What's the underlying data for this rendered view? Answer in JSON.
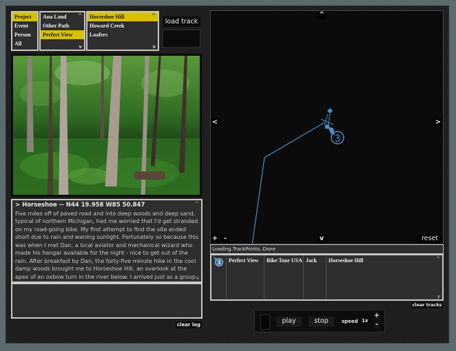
{
  "categories": {
    "items": [
      {
        "label": "Project",
        "selected": true
      },
      {
        "label": "Event",
        "selected": false
      },
      {
        "label": "Person",
        "selected": false
      },
      {
        "label": "All",
        "selected": false
      }
    ]
  },
  "projects": {
    "items": [
      {
        "label": "Ana Land",
        "selected": false
      },
      {
        "label": "Other Path",
        "selected": false
      },
      {
        "label": "Perfect View",
        "selected": true
      }
    ],
    "scroll_up": "^",
    "scroll_down": "v"
  },
  "entries": {
    "items": [
      {
        "label": "Horseshoe Hill",
        "selected": true
      },
      {
        "label": "Howard Creek",
        "selected": false
      },
      {
        "label": "Loafers",
        "selected": false
      }
    ],
    "scroll_up": "^",
    "scroll_down": "v"
  },
  "load_track_label": "load track",
  "photo": {
    "subject": "forest-with-birch-trees-and-ferns"
  },
  "entry_text": {
    "header": "> Horseshoe -- N44 19.958  W85 50.847",
    "body": "Five miles off of paved road and into deep woods and deep sand, typical of northern Michigan, had me worried that I'd get stranded on my road-going bike. My first attempt to find the site ended short due to rain and waning sunlight. Fortunately so because this was when I met Dan, a local aviator and mechanical wizard who made his hangar available for the night - nice to get out of the rain. After breakfast by Dan, the forty-five minute hike in the cool damp woods brought me to Horseshoe Hill, an overlook at the apex of an oxbow turn in the river below. I arrived just as a group of canoes made their way downstream - I wasn't alone after all.",
    "scroll_up": "^",
    "scroll_down": "v"
  },
  "log": {
    "text": "",
    "clear_label": "clear log"
  },
  "map": {
    "pan_up": "^",
    "pan_down": "v",
    "pan_left": "<",
    "pan_right": ">",
    "zoom_in": "+",
    "zoom_out": "-",
    "reset": "reset",
    "track_color": "#4a90c8",
    "marker_label": "3"
  },
  "status": {
    "text": "Loading.TrackPoints..Done"
  },
  "tracks": {
    "rows": [
      {
        "marker": "3",
        "project": "Perfect View",
        "event": "Bike Tour USA",
        "person": "Jack",
        "entry": "Horseshoe Hill"
      }
    ],
    "scroll_up": "^",
    "scroll_down": "v",
    "clear_label": "clear tracks"
  },
  "playback": {
    "play_label": "play",
    "stop_label": "stop",
    "speed_label": "speed",
    "speed_value": "1x",
    "speed_up": "+",
    "speed_down": "-"
  },
  "colors": {
    "background": "#5b6b6e",
    "panel": "#1e1f1e",
    "selection": "#d6c000",
    "track": "#4a90c8"
  }
}
